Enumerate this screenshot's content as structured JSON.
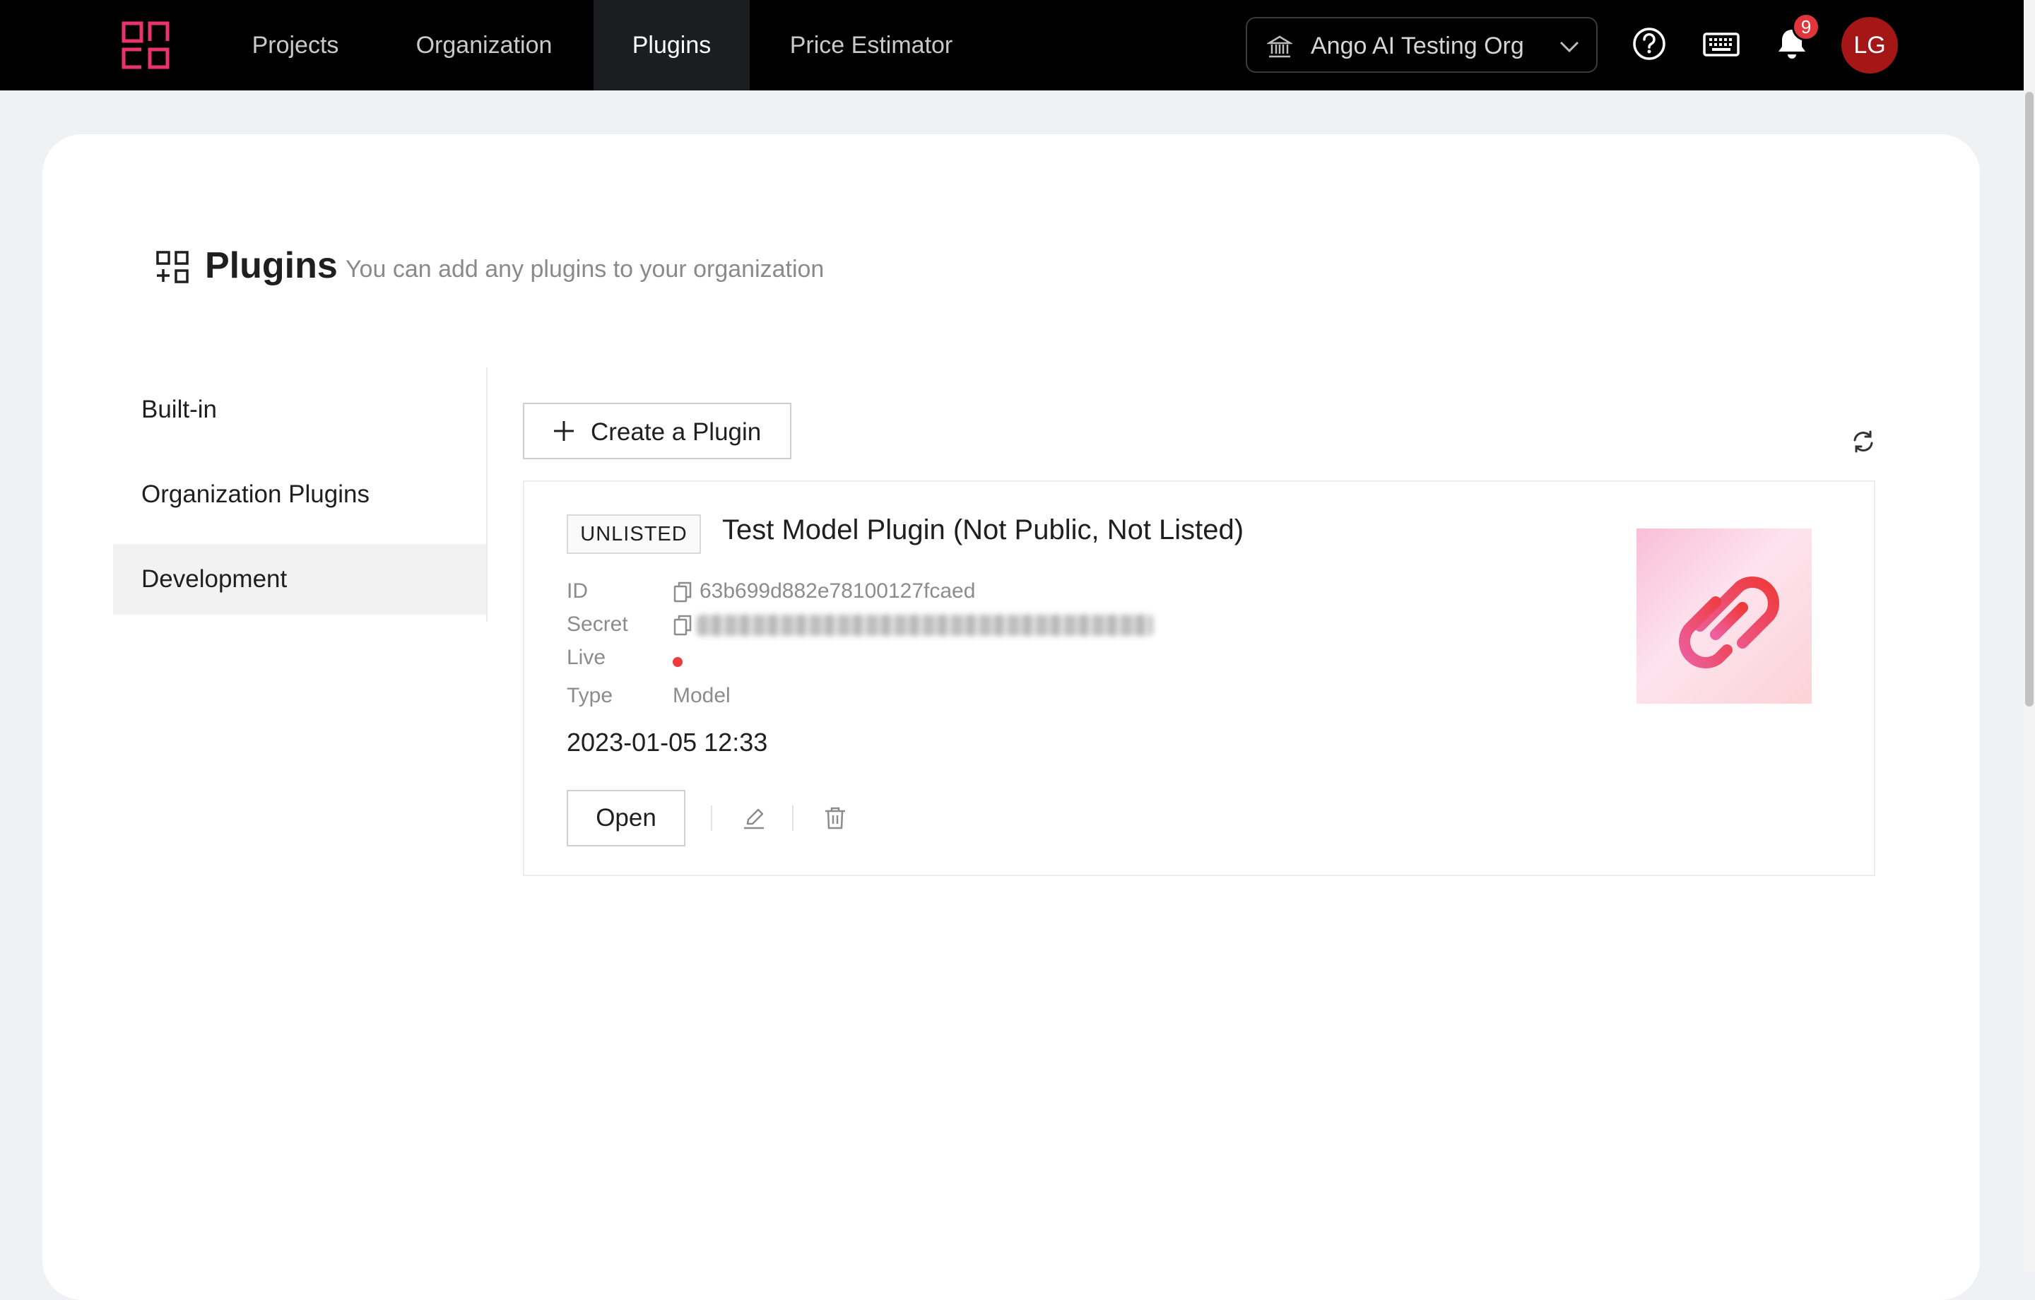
{
  "nav": {
    "items": [
      "Projects",
      "Organization",
      "Plugins",
      "Price Estimator"
    ],
    "active": "Plugins",
    "org_selector": "Ango AI Testing Org",
    "notifications_count": "9",
    "avatar_initials": "LG",
    "brand_color": "#e8336d"
  },
  "header": {
    "title": "Plugins",
    "subtitle": "You can add any plugins to your organization"
  },
  "sidebar": {
    "items": [
      "Built-in",
      "Organization Plugins",
      "Development"
    ],
    "active": "Development"
  },
  "toolbar": {
    "create_label": "Create a Plugin"
  },
  "plugin": {
    "tag": "UNLISTED",
    "title": "Test Model Plugin (Not Public, Not Listed)",
    "labels": {
      "id": "ID",
      "secret": "Secret",
      "live": "Live",
      "type": "Type"
    },
    "id_value": "63b699d882e78100127fcaed",
    "type_value": "Model",
    "live_status_color": "#ef3b3b",
    "date": "2023-01-05 12:33",
    "open_label": "Open"
  }
}
